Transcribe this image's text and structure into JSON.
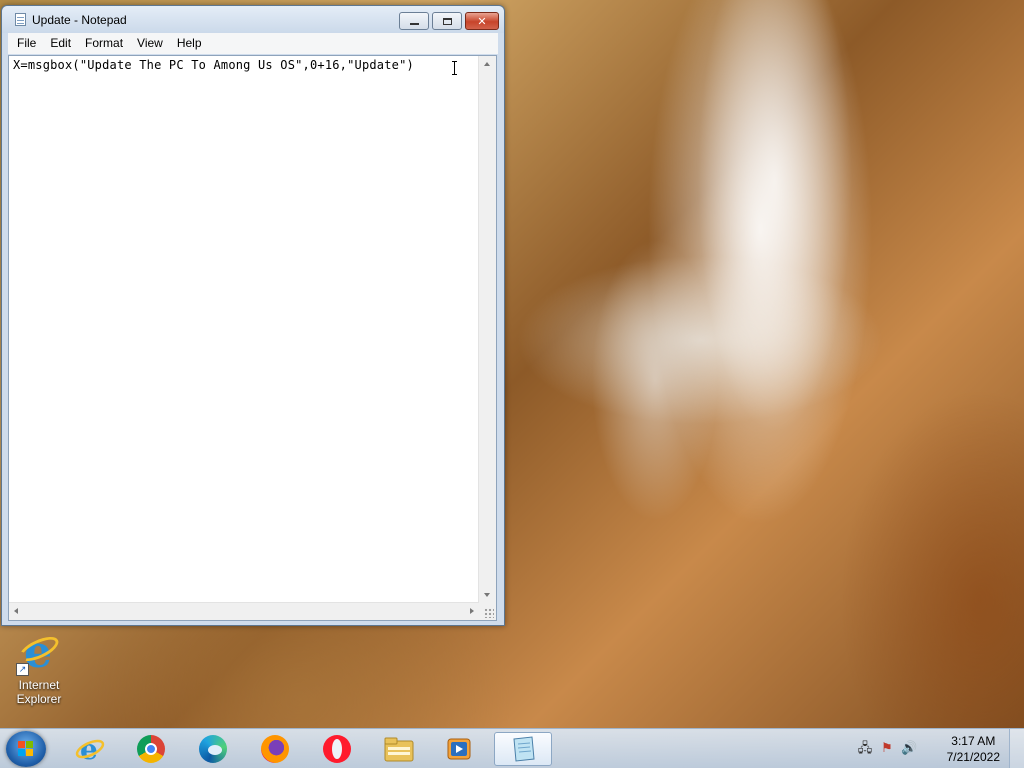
{
  "window": {
    "title": "Update - Notepad",
    "close_glyph": "✕",
    "menu": [
      "File",
      "Edit",
      "Format",
      "View",
      "Help"
    ],
    "content": "X=msgbox(\"Update The PC To Among Us OS\",0+16,\"Update\")"
  },
  "desktop": {
    "icons": [
      {
        "label_line1": "Internet",
        "label_line2": "Explorer",
        "icon": "internet-explorer-icon"
      }
    ]
  },
  "taskbar": {
    "pinned": [
      {
        "name": "internet-explorer-icon"
      },
      {
        "name": "chrome-icon"
      },
      {
        "name": "edge-icon"
      },
      {
        "name": "firefox-icon"
      },
      {
        "name": "opera-icon"
      },
      {
        "name": "file-explorer-icon"
      },
      {
        "name": "media-player-icon"
      },
      {
        "name": "notepad-icon",
        "active": true
      }
    ],
    "clock": {
      "time": "3:17 AM",
      "date": "7/21/2022"
    }
  },
  "colors": {
    "accent": "#1f5ea8",
    "close_button": "#c7442a"
  }
}
